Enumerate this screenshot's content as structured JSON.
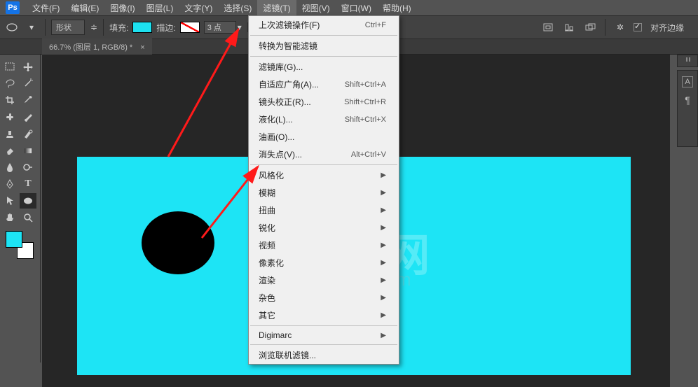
{
  "menubar": {
    "items": [
      "文件(F)",
      "编辑(E)",
      "图像(I)",
      "图层(L)",
      "文字(Y)",
      "选择(S)",
      "滤镜(T)",
      "视图(V)",
      "窗口(W)",
      "帮助(H)"
    ],
    "active_index": 6
  },
  "optionsbar": {
    "shape_mode": "形状",
    "fill_label": "填充:",
    "stroke_label": "描边:",
    "stroke_width": "3 点",
    "align_label": "对齐边缘"
  },
  "tab": {
    "title": "66.7% (图层 1, RGB/8) *"
  },
  "dropdown": {
    "groups": [
      [
        {
          "label": "上次滤镜操作(F)",
          "shortcut": "Ctrl+F"
        }
      ],
      [
        {
          "label": "转换为智能滤镜"
        }
      ],
      [
        {
          "label": "滤镜库(G)..."
        },
        {
          "label": "自适应广角(A)...",
          "shortcut": "Shift+Ctrl+A"
        },
        {
          "label": "镜头校正(R)...",
          "shortcut": "Shift+Ctrl+R"
        },
        {
          "label": "液化(L)...",
          "shortcut": "Shift+Ctrl+X"
        },
        {
          "label": "油画(O)..."
        },
        {
          "label": "消失点(V)...",
          "shortcut": "Alt+Ctrl+V"
        }
      ],
      [
        {
          "label": "风格化",
          "submenu": true
        },
        {
          "label": "模糊",
          "submenu": true
        },
        {
          "label": "扭曲",
          "submenu": true
        },
        {
          "label": "锐化",
          "submenu": true
        },
        {
          "label": "视频",
          "submenu": true
        },
        {
          "label": "像素化",
          "submenu": true
        },
        {
          "label": "渲染",
          "submenu": true
        },
        {
          "label": "杂色",
          "submenu": true
        },
        {
          "label": "其它",
          "submenu": true
        }
      ],
      [
        {
          "label": "Digimarc",
          "submenu": true
        }
      ],
      [
        {
          "label": "浏览联机滤镜..."
        }
      ]
    ]
  },
  "watermark": {
    "big": "GX · 网",
    "sub": "system.com"
  }
}
